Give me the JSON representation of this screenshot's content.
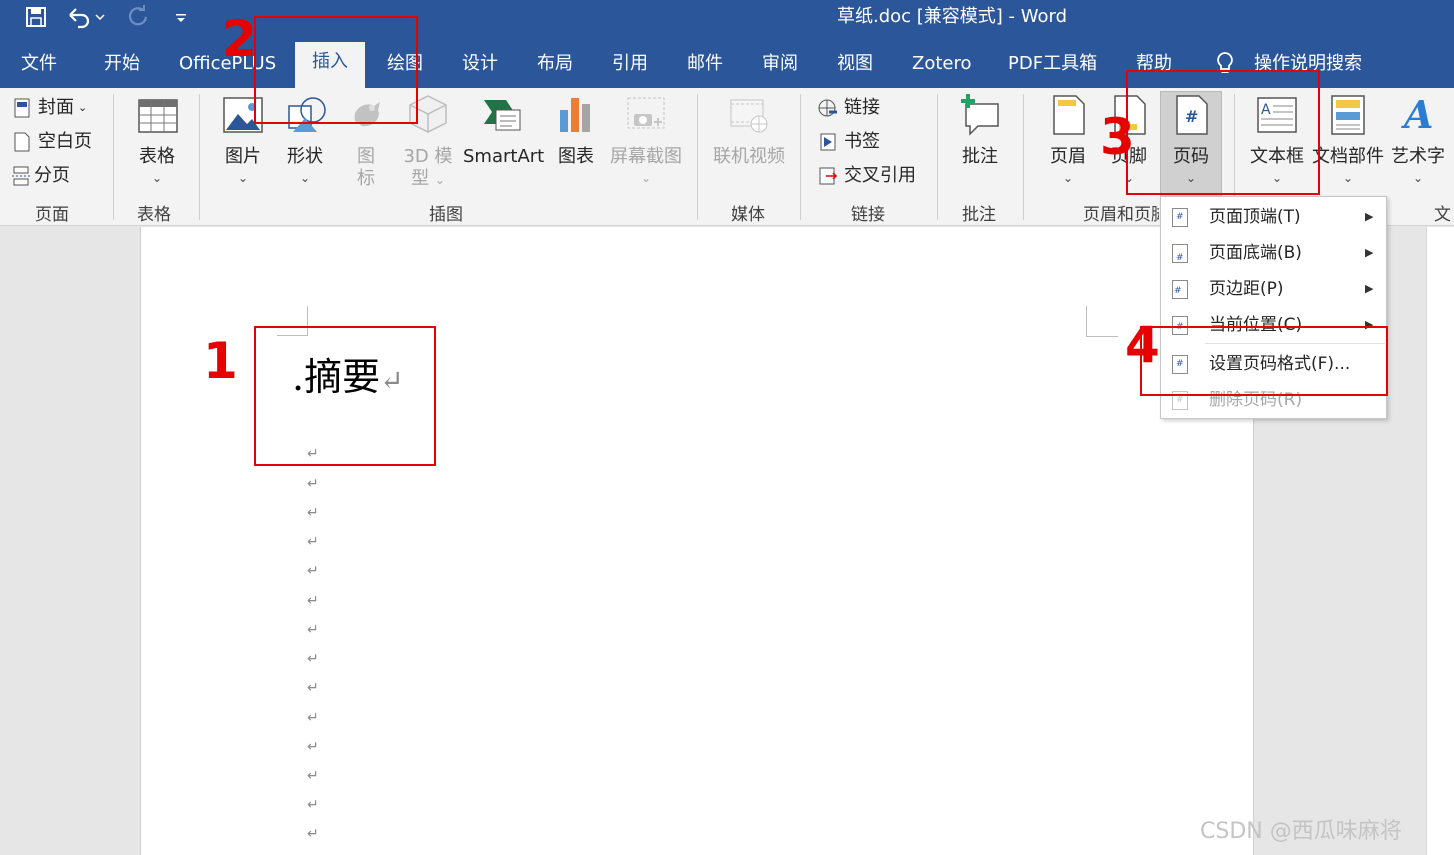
{
  "window": {
    "title": "草纸.doc [兼容模式]  -  Word"
  },
  "quick_access": {
    "save_icon": "save-icon",
    "undo_icon": "undo-icon",
    "redo_icon": "redo-icon",
    "customize_icon": "customize-icon"
  },
  "tabs": [
    "文件",
    "开始",
    "OfficePLUS",
    "插入",
    "绘图",
    "设计",
    "布局",
    "引用",
    "邮件",
    "审阅",
    "视图",
    "Zotero",
    "PDF工具箱",
    "帮助"
  ],
  "active_tab": "插入",
  "tell_me": "操作说明搜索",
  "ribbon": {
    "pages_group": {
      "label": "页面",
      "cover": "封面",
      "blank": "空白页",
      "break": "分页"
    },
    "table_group": {
      "label": "表格",
      "table": "表格"
    },
    "illustrations_group": {
      "label": "插图",
      "pictures": "图片",
      "shapes": "形状",
      "icons": "图\n标",
      "icons_l1": "图",
      "icons_l2": "标",
      "models_l1": "3D 模",
      "models_l2": "型",
      "smartart": "SmartArt",
      "chart": "图表",
      "screenshot": "屏幕截图"
    },
    "media_group": {
      "label": "媒体",
      "video": "联机视频"
    },
    "links_group": {
      "label": "链接",
      "link": "链接",
      "bookmark": "书签",
      "crossref": "交叉引用"
    },
    "comments_group": {
      "label": "批注",
      "comment": "批注"
    },
    "header_footer_group": {
      "label": "页眉和页脚",
      "header": "页眉",
      "footer": "页脚",
      "page_number": "页码"
    },
    "text_group": {
      "label": "文",
      "textbox": "文本框",
      "quickparts": "文档部件",
      "wordart": "艺术字"
    }
  },
  "document": {
    "heading": ".摘要",
    "paragraph_mark": "↵"
  },
  "page_number_menu": {
    "items": [
      {
        "label": "页面顶端(T)",
        "submenu": true,
        "disabled": false
      },
      {
        "label": "页面底端(B)",
        "submenu": true,
        "disabled": false
      },
      {
        "label": "页边距(P)",
        "submenu": true,
        "disabled": false
      },
      {
        "label": "当前位置(C)",
        "submenu": true,
        "disabled": false
      },
      {
        "label": "设置页码格式(F)...",
        "submenu": false,
        "disabled": false
      },
      {
        "label": "删除页码(R)",
        "submenu": false,
        "disabled": true
      }
    ]
  },
  "annotations": {
    "n1": "1",
    "n2": "2",
    "n3": "3",
    "n4": "4"
  },
  "watermark": "CSDN @西瓜味麻将",
  "colors": {
    "brand": "#2b579a",
    "ribbon": "#f3f3f3",
    "annotation": "#e60000"
  }
}
